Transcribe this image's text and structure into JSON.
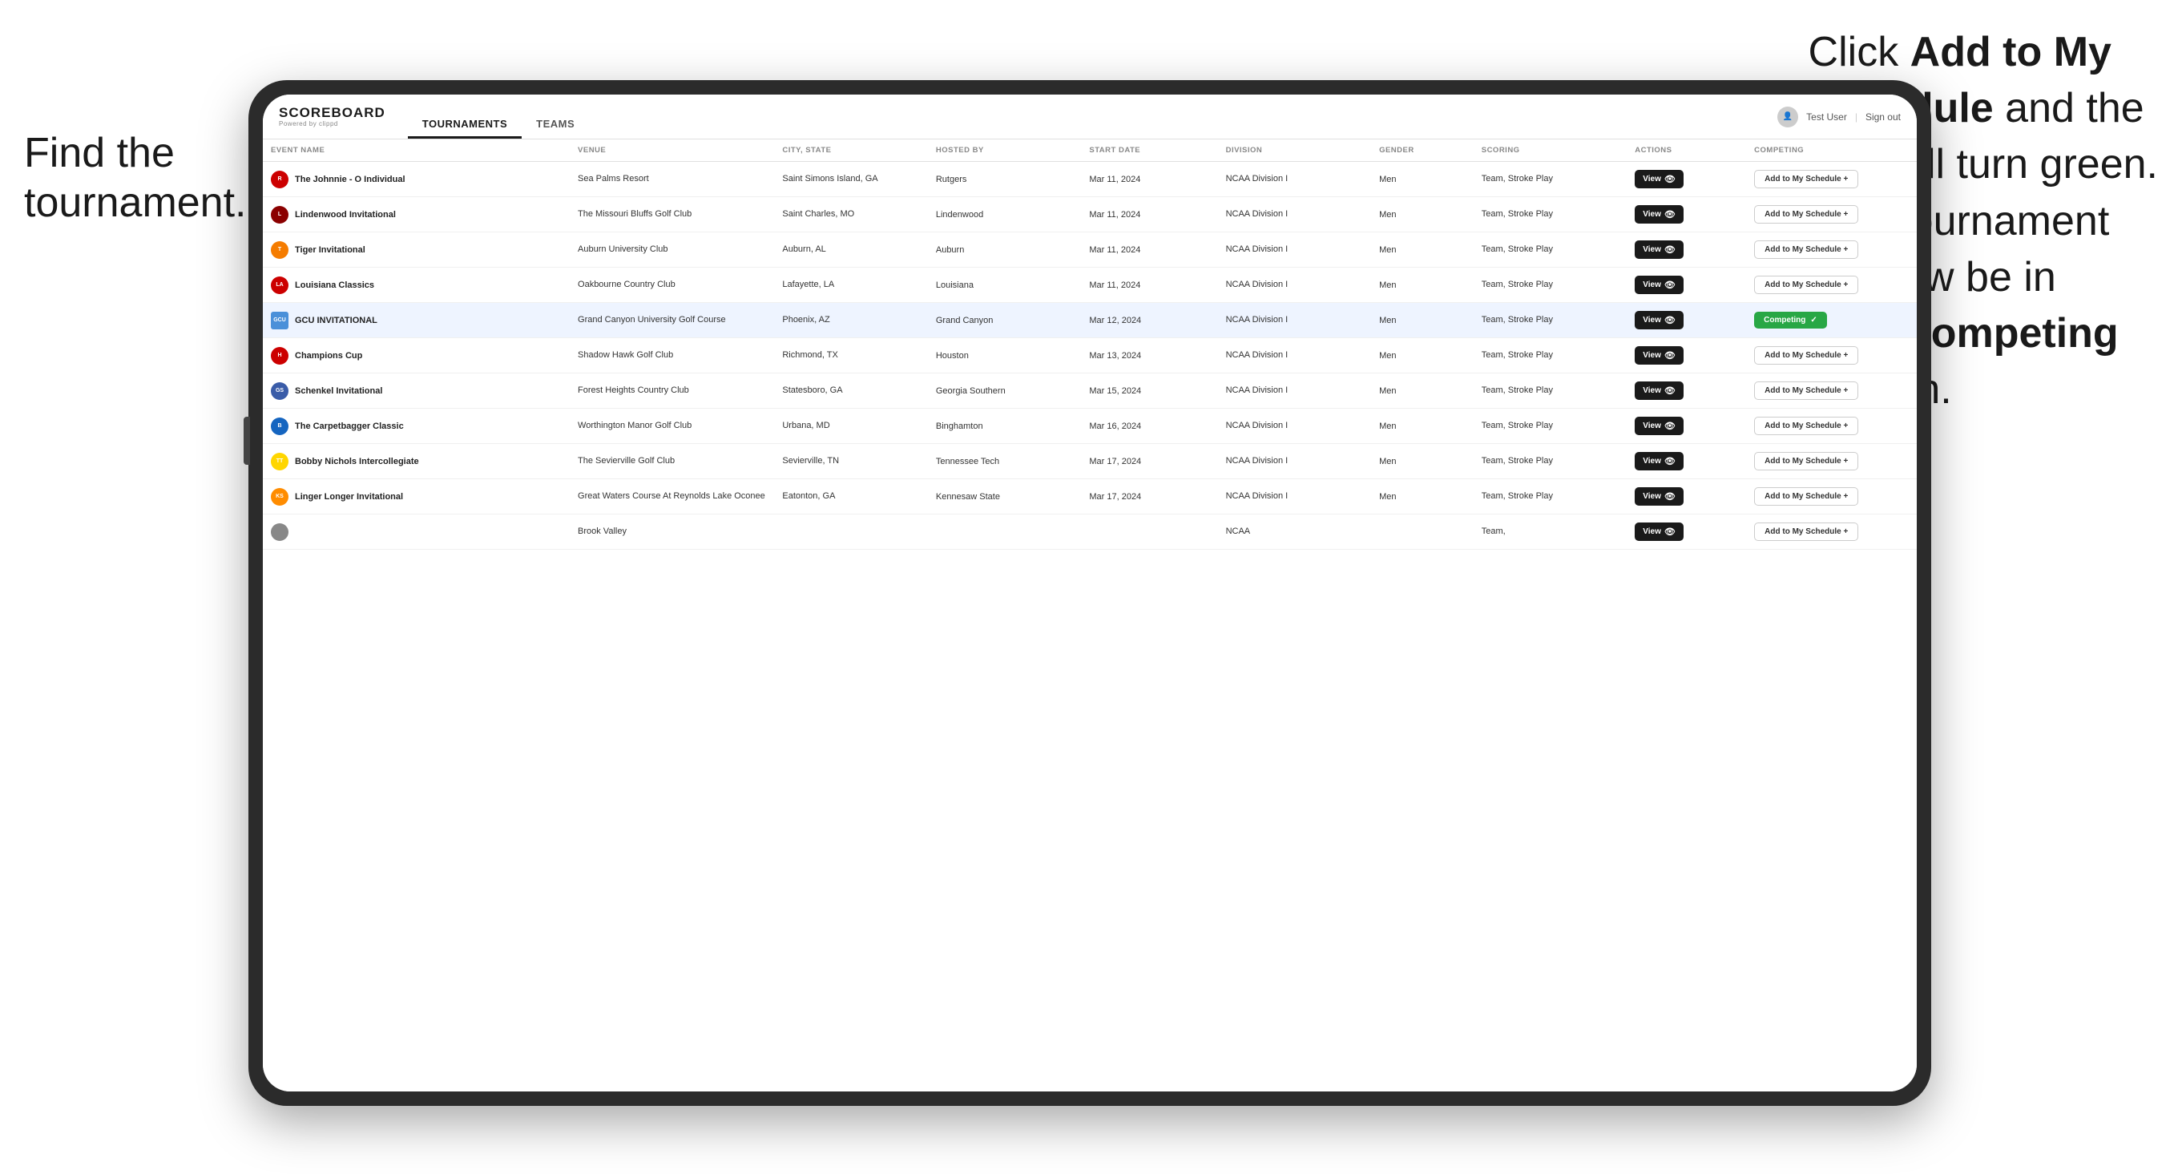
{
  "annotations": {
    "left": "Find the\ntournament.",
    "right_line1": "Click ",
    "right_bold1": "Add to My\nSchedule",
    "right_line2": " and the\nbox will turn green.\nThis tournament\nwill now be in\nyour ",
    "right_bold2": "Competing",
    "right_line3": "\nsection."
  },
  "header": {
    "logo_title": "SCOREBOARD",
    "logo_subtitle": "Powered by clippd",
    "nav_tournaments": "TOURNAMENTS",
    "nav_teams": "TEAMS",
    "user_label": "Test User",
    "sign_out": "Sign out"
  },
  "table": {
    "columns": [
      "EVENT NAME",
      "VENUE",
      "CITY, STATE",
      "HOSTED BY",
      "START DATE",
      "DIVISION",
      "GENDER",
      "SCORING",
      "ACTIONS",
      "COMPETING"
    ],
    "rows": [
      {
        "logo": "🔴",
        "event_name": "The Johnnie - O Individual",
        "venue": "Sea Palms Resort",
        "city_state": "Saint Simons Island, GA",
        "hosted_by": "Rutgers",
        "start_date": "Mar 11, 2024",
        "division": "NCAA Division I",
        "gender": "Men",
        "scoring": "Team, Stroke Play",
        "action": "View",
        "competing": "Add to My Schedule +",
        "is_competing": false,
        "highlighted": false
      },
      {
        "logo": "🦁",
        "event_name": "Lindenwood Invitational",
        "venue": "The Missouri Bluffs Golf Club",
        "city_state": "Saint Charles, MO",
        "hosted_by": "Lindenwood",
        "start_date": "Mar 11, 2024",
        "division": "NCAA Division I",
        "gender": "Men",
        "scoring": "Team, Stroke Play",
        "action": "View",
        "competing": "Add to My Schedule +",
        "is_competing": false,
        "highlighted": false
      },
      {
        "logo": "🐯",
        "event_name": "Tiger Invitational",
        "venue": "Auburn University Club",
        "city_state": "Auburn, AL",
        "hosted_by": "Auburn",
        "start_date": "Mar 11, 2024",
        "division": "NCAA Division I",
        "gender": "Men",
        "scoring": "Team, Stroke Play",
        "action": "View",
        "competing": "Add to My Schedule +",
        "is_competing": false,
        "highlighted": false
      },
      {
        "logo": "🔴",
        "event_name": "Louisiana Classics",
        "venue": "Oakbourne Country Club",
        "city_state": "Lafayette, LA",
        "hosted_by": "Louisiana",
        "start_date": "Mar 11, 2024",
        "division": "NCAA Division I",
        "gender": "Men",
        "scoring": "Team, Stroke Play",
        "action": "View",
        "competing": "Add to My Schedule +",
        "is_competing": false,
        "highlighted": false
      },
      {
        "logo": "🦅",
        "event_name": "GCU INVITATIONAL",
        "venue": "Grand Canyon University Golf Course",
        "city_state": "Phoenix, AZ",
        "hosted_by": "Grand Canyon",
        "start_date": "Mar 12, 2024",
        "division": "NCAA Division I",
        "gender": "Men",
        "scoring": "Team, Stroke Play",
        "action": "View",
        "competing": "Competing ✓",
        "is_competing": true,
        "highlighted": true
      },
      {
        "logo": "🔴",
        "event_name": "Champions Cup",
        "venue": "Shadow Hawk Golf Club",
        "city_state": "Richmond, TX",
        "hosted_by": "Houston",
        "start_date": "Mar 13, 2024",
        "division": "NCAA Division I",
        "gender": "Men",
        "scoring": "Team, Stroke Play",
        "action": "View",
        "competing": "Add to My Schedule +",
        "is_competing": false,
        "highlighted": false
      },
      {
        "logo": "🟢",
        "event_name": "Schenkel Invitational",
        "venue": "Forest Heights Country Club",
        "city_state": "Statesboro, GA",
        "hosted_by": "Georgia Southern",
        "start_date": "Mar 15, 2024",
        "division": "NCAA Division I",
        "gender": "Men",
        "scoring": "Team, Stroke Play",
        "action": "View",
        "competing": "Add to My Schedule +",
        "is_competing": false,
        "highlighted": false
      },
      {
        "logo": "🔵",
        "event_name": "The Carpetbagger Classic",
        "venue": "Worthington Manor Golf Club",
        "city_state": "Urbana, MD",
        "hosted_by": "Binghamton",
        "start_date": "Mar 16, 2024",
        "division": "NCAA Division I",
        "gender": "Men",
        "scoring": "Team, Stroke Play",
        "action": "View",
        "competing": "Add to My Schedule +",
        "is_competing": false,
        "highlighted": false
      },
      {
        "logo": "🟡",
        "event_name": "Bobby Nichols Intercollegiate",
        "venue": "The Sevierville Golf Club",
        "city_state": "Sevierville, TN",
        "hosted_by": "Tennessee Tech",
        "start_date": "Mar 17, 2024",
        "division": "NCAA Division I",
        "gender": "Men",
        "scoring": "Team, Stroke Play",
        "action": "View",
        "competing": "Add to My Schedule +",
        "is_competing": false,
        "highlighted": false
      },
      {
        "logo": "🟠",
        "event_name": "Linger Longer Invitational",
        "venue": "Great Waters Course At Reynolds Lake Oconee",
        "city_state": "Eatonton, GA",
        "hosted_by": "Kennesaw State",
        "start_date": "Mar 17, 2024",
        "division": "NCAA Division I",
        "gender": "Men",
        "scoring": "Team, Stroke Play",
        "action": "View",
        "competing": "Add to My Schedule +",
        "is_competing": false,
        "highlighted": false
      },
      {
        "logo": "⚪",
        "event_name": "",
        "venue": "Brook Valley",
        "city_state": "",
        "hosted_by": "",
        "start_date": "",
        "division": "NCAA",
        "gender": "",
        "scoring": "Team,",
        "action": "View",
        "competing": "Add to My Schedule +",
        "is_competing": false,
        "highlighted": false
      }
    ]
  },
  "colors": {
    "competing_green": "#28a745",
    "view_dark": "#1a1a1a",
    "highlighted_row": "#eef4ff",
    "arrow_pink": "#e8357a"
  }
}
